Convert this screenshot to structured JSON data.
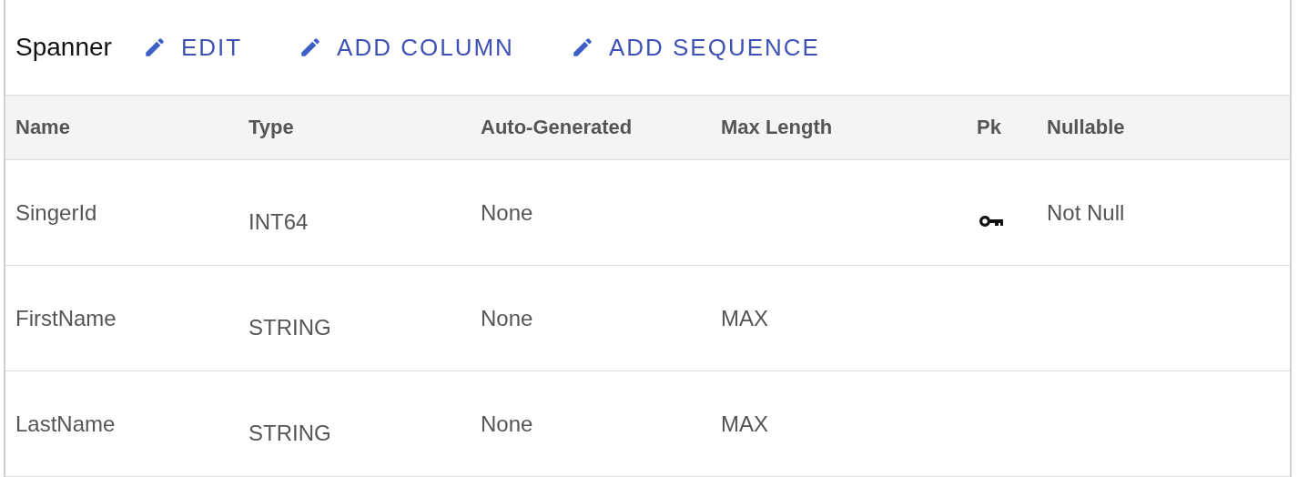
{
  "toolbar": {
    "title": "Spanner",
    "buttons": [
      {
        "label": "EDIT"
      },
      {
        "label": "ADD COLUMN"
      },
      {
        "label": "ADD SEQUENCE"
      }
    ]
  },
  "table": {
    "columns": [
      "Name",
      "Type",
      "Auto-Generated",
      "Max Length",
      "Pk",
      "Nullable"
    ],
    "rows": [
      {
        "name": "SingerId",
        "type": "INT64",
        "auto_generated": "None",
        "pk": true,
        "nullable": "Not Null"
      },
      {
        "name": "FirstName",
        "type": "STRING",
        "auto_generated": "None",
        "max_length": "MAX",
        "pk": false
      },
      {
        "name": "LastName",
        "type": "STRING",
        "auto_generated": "None",
        "max_length": "MAX",
        "pk": false
      }
    ]
  }
}
